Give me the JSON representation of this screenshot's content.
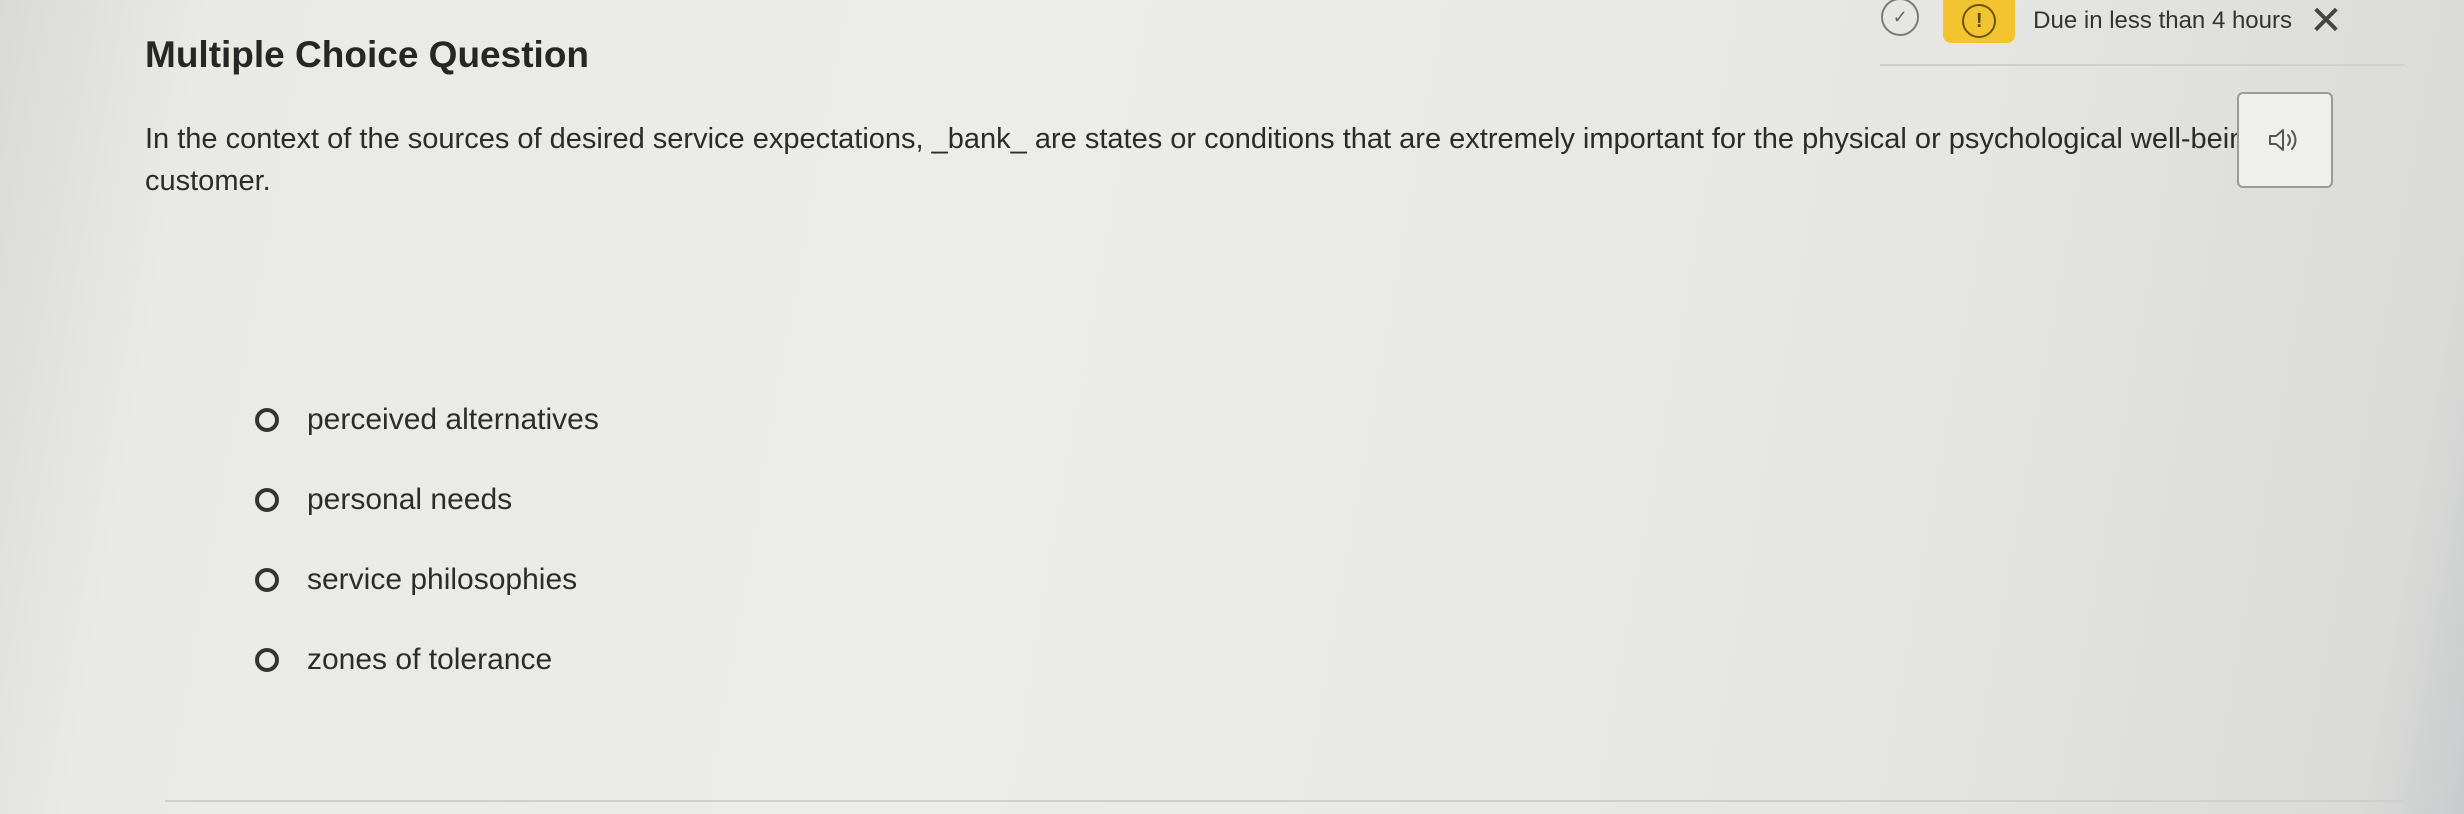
{
  "header": {
    "due_text": "Due in less than 4 hours",
    "warn_symbol": "!",
    "check_symbol": "✓",
    "close_symbol": "✕"
  },
  "question": {
    "type_title": "Multiple Choice Question",
    "prompt": "In the context of the sources of desired service expectations, _bank_ are states or conditions that are extremely important for the physical or psychological well-being of a customer.",
    "options": [
      {
        "label": "perceived alternatives",
        "selected": false
      },
      {
        "label": "personal needs",
        "selected": false
      },
      {
        "label": "service philosophies",
        "selected": false
      },
      {
        "label": "zones of tolerance",
        "selected": false
      }
    ]
  },
  "icons": {
    "audio": "speaker-icon",
    "check": "check-circle-icon",
    "warning": "warning-icon",
    "close": "close-icon"
  },
  "colors": {
    "warning_badge": "#f2c530",
    "text": "#2a2a2a"
  }
}
